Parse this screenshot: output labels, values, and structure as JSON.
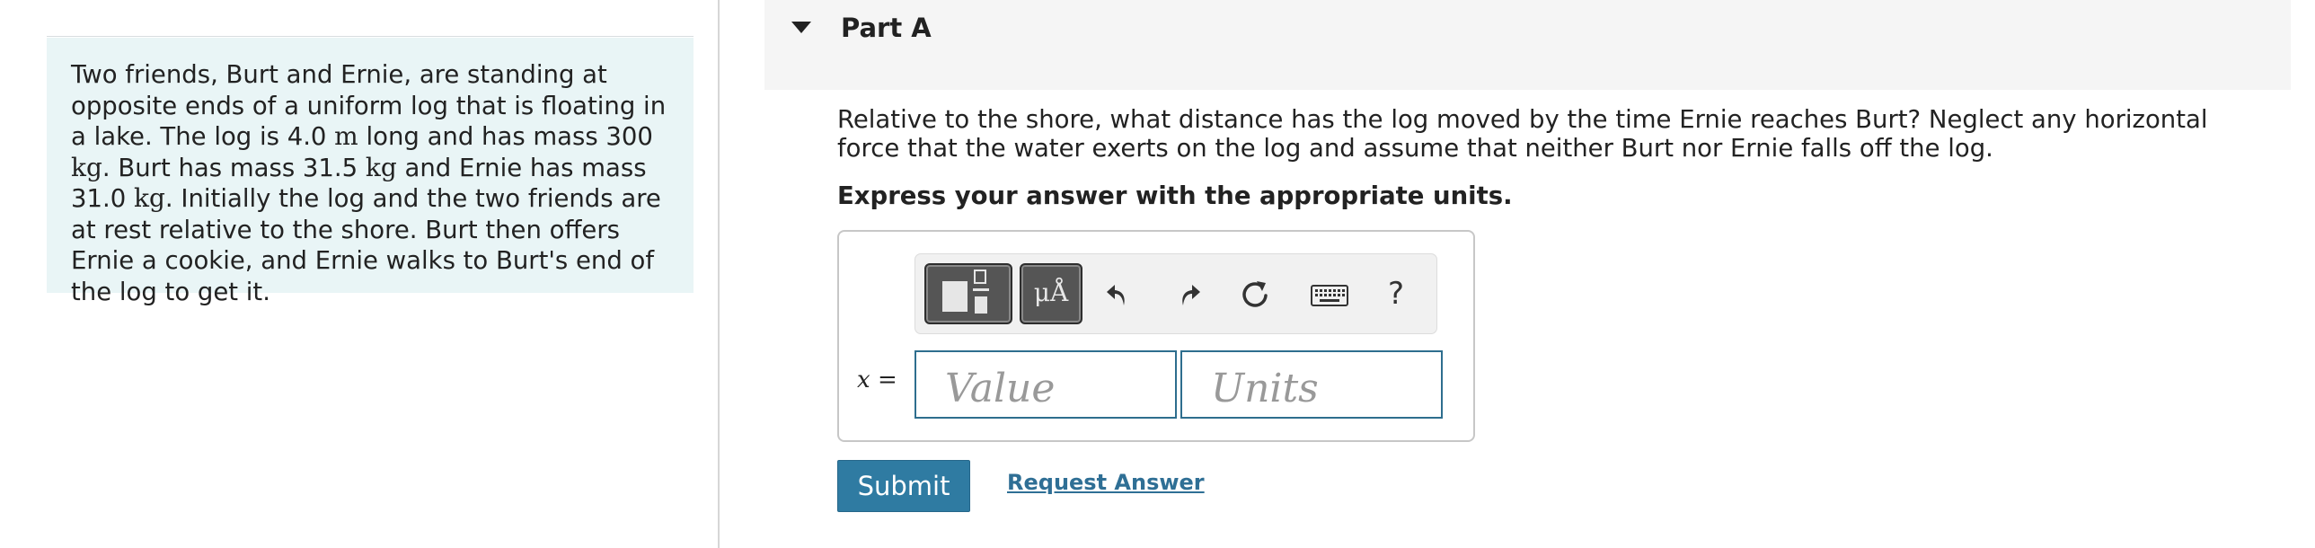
{
  "problem": {
    "text_1": "Two friends, Burt and Ernie, are standing at opposite ends of a uniform log that is floating in a lake. The log is 4.0 ",
    "unit_m": "m",
    "text_2": " long and has mass 300 ",
    "unit_kg_1": "kg",
    "text_3": ". Burt has mass 31.5 ",
    "unit_kg_2": "kg",
    "text_4": " and Ernie has mass 31.0 ",
    "unit_kg_3": "kg",
    "text_5": ". Initially the log and the two friends are at rest relative to the shore. Burt then offers Ernie a cookie, and Ernie walks to Burt's end of the log to get it."
  },
  "part": {
    "title": "Part A",
    "caret_icon": "caret-down-icon"
  },
  "question": {
    "text": "Relative to the shore, what distance has the log moved by the time Ernie reaches Burt? Neglect any horizontal force that the water exerts on the log and assume that neither Burt nor Ernie falls off the log.",
    "instruction": "Express your answer with the appropriate units."
  },
  "toolbar": {
    "units_label": "μÅ",
    "help_label": "?",
    "icons": [
      "templates-icon",
      "units-icon",
      "undo-icon",
      "redo-icon",
      "reset-icon",
      "keyboard-icon",
      "help-icon"
    ]
  },
  "answer": {
    "variable": "x",
    "equals": "=",
    "value_placeholder": "Value",
    "units_placeholder": "Units"
  },
  "actions": {
    "submit_label": "Submit",
    "request_label": "Request Answer"
  },
  "colors": {
    "problem_bg": "#e9f5f6",
    "header_bg": "#f5f5f5",
    "accent": "#2f7ba2",
    "link": "#2f6f95",
    "field_border": "#2e6e8e"
  }
}
